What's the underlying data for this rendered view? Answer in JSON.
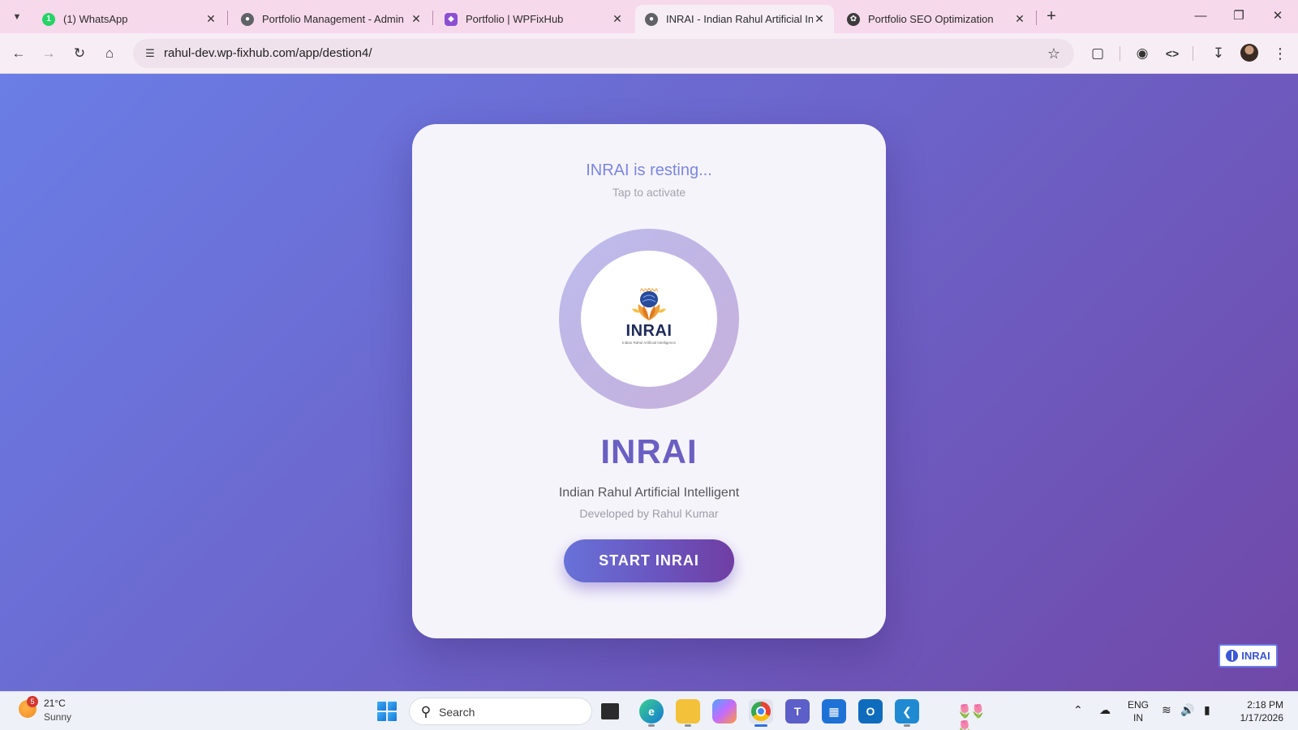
{
  "browser": {
    "tabs": [
      {
        "title": "(1) WhatsApp",
        "icon": "whatsapp-icon",
        "active": false
      },
      {
        "title": "Portfolio Management - Admin",
        "icon": "globe-icon",
        "active": false
      },
      {
        "title": "Portfolio | WPFixHub",
        "icon": "shield-icon",
        "active": false
      },
      {
        "title": "INRAI - Indian Rahul Artificial In",
        "icon": "globe-icon",
        "active": true
      },
      {
        "title": "Portfolio SEO Optimization",
        "icon": "openai-icon",
        "active": false
      }
    ],
    "address_bar": {
      "url": "rahul-dev.wp-fixhub.com/app/destion4/"
    }
  },
  "page": {
    "status_text": "INRAI is resting...",
    "hint_text": "Tap to activate",
    "logo": {
      "wordmark": "INRAI",
      "tagline": "Indian Rahul Artificial Intelligence"
    },
    "brand_title": "INRAI",
    "full_name": "Indian Rahul Artificial Intelligent",
    "developer_credit": "Developed by Rahul Kumar",
    "start_button_label": "START INRAI",
    "corner_badge_label": "INRAI",
    "colors": {
      "accent": "#6a5fc2",
      "status": "#7b86e0",
      "gradient_start": "#6a7ee6",
      "gradient_end": "#7048a8"
    }
  },
  "taskbar": {
    "weather": {
      "temp": "21°C",
      "condition": "Sunny",
      "alerts": "5"
    },
    "search_placeholder": "Search",
    "apps": [
      "task-view",
      "edge",
      "file-explorer",
      "copilot",
      "chrome",
      "teams",
      "store",
      "outlook",
      "vscode"
    ],
    "language": {
      "line1": "ENG",
      "line2": "IN"
    },
    "clock": {
      "time": "2:18 PM",
      "date": "1/17/2026"
    }
  }
}
